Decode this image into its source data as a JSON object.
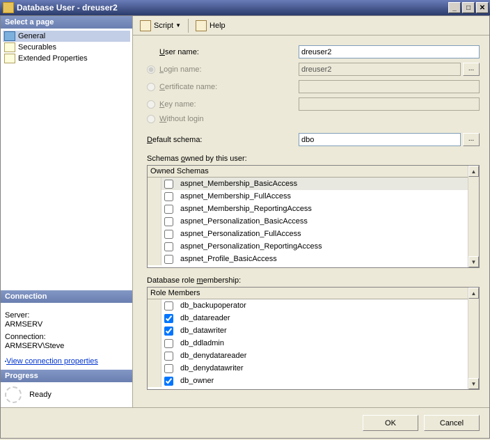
{
  "window": {
    "title": "Database User - dreuser2"
  },
  "sidebar": {
    "select_header": "Select a page",
    "items": [
      {
        "label": "General",
        "selected": true
      },
      {
        "label": "Securables",
        "selected": false
      },
      {
        "label": "Extended Properties",
        "selected": false
      }
    ],
    "connection_header": "Connection",
    "server_label": "Server:",
    "server_value": "ARMSERV",
    "connection_label": "Connection:",
    "connection_value": "ARMSERV\\Steve",
    "view_conn_props": "View connection properties",
    "progress_header": "Progress",
    "progress_status": "Ready"
  },
  "toolbar": {
    "script_label": "Script",
    "help_label": "Help"
  },
  "form": {
    "user_name_label": "User name:",
    "user_name_value": "dreuser2",
    "login_name_label": "Login name:",
    "login_name_value": "dreuser2",
    "cert_name_label": "Certificate name:",
    "key_name_label": "Key name:",
    "without_login_label": "Without login",
    "default_schema_label": "Default schema:",
    "default_schema_value": "dbo",
    "schemas_label": "Schemas owned by this user:",
    "schemas_header": "Owned Schemas",
    "schemas": [
      {
        "name": "aspnet_Membership_BasicAccess",
        "checked": false
      },
      {
        "name": "aspnet_Membership_FullAccess",
        "checked": false
      },
      {
        "name": "aspnet_Membership_ReportingAccess",
        "checked": false
      },
      {
        "name": "aspnet_Personalization_BasicAccess",
        "checked": false
      },
      {
        "name": "aspnet_Personalization_FullAccess",
        "checked": false
      },
      {
        "name": "aspnet_Personalization_ReportingAccess",
        "checked": false
      },
      {
        "name": "aspnet_Profile_BasicAccess",
        "checked": false
      }
    ],
    "roles_label": "Database role membership:",
    "roles_header": "Role Members",
    "roles": [
      {
        "name": "db_backupoperator",
        "checked": false
      },
      {
        "name": "db_datareader",
        "checked": true
      },
      {
        "name": "db_datawriter",
        "checked": true
      },
      {
        "name": "db_ddladmin",
        "checked": false
      },
      {
        "name": "db_denydatareader",
        "checked": false
      },
      {
        "name": "db_denydatawriter",
        "checked": false
      },
      {
        "name": "db_owner",
        "checked": true
      }
    ]
  },
  "footer": {
    "ok_label": "OK",
    "cancel_label": "Cancel"
  }
}
